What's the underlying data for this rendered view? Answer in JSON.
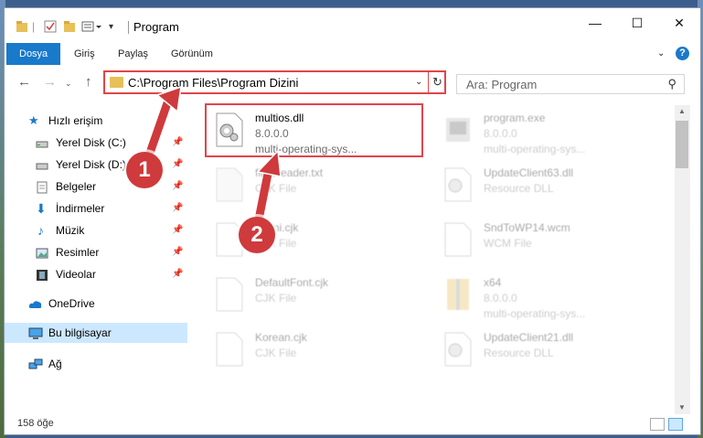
{
  "titlebar": {
    "title": "Program",
    "minimize": "—",
    "maximize": "☐",
    "close": "✕"
  },
  "ribbon": {
    "tabs": [
      "Dosya",
      "Giriş",
      "Paylaş",
      "Görünüm"
    ],
    "active_tab": "Dosya",
    "help": "?"
  },
  "address": {
    "path": "C:\\Program Files\\Program Dizini",
    "search_placeholder": "Ara: Program"
  },
  "nav": {
    "items": [
      {
        "label": "Hızlı erişim",
        "icon": "star-icon"
      },
      {
        "label": "Yerel Disk (C:)",
        "icon": "drive-icon"
      },
      {
        "label": "Yerel Disk (D:)",
        "icon": "drive-icon"
      },
      {
        "label": "Belgeler",
        "icon": "documents-icon"
      },
      {
        "label": "İndirmeler",
        "icon": "download-icon"
      },
      {
        "label": "Müzik",
        "icon": "music-icon"
      },
      {
        "label": "Resimler",
        "icon": "pictures-icon"
      },
      {
        "label": "Videolar",
        "icon": "video-icon"
      },
      {
        "label": "OneDrive",
        "icon": "cloud-icon"
      },
      {
        "label": "Bu bilgisayar",
        "icon": "computer-icon"
      },
      {
        "label": "Ağ",
        "icon": "network-icon"
      }
    ]
  },
  "files": [
    {
      "name": "multios.dll",
      "line2": "8.0.0.0",
      "line3": "multi-operating-sys..."
    },
    {
      "name": "program.exe",
      "line2": "8.0.0.0",
      "line3": "multi-operating-sys..."
    },
    {
      "name": "fineReader.txt",
      "line2": "CJK File",
      "line3": ""
    },
    {
      "name": "UpdateClient63.dll",
      "line2": "Resource DLL",
      "line3": ""
    },
    {
      "name": "fehmi.cjk",
      "line2": "CJK File",
      "line3": ""
    },
    {
      "name": "SndToWP14.wcm",
      "line2": "WCM File",
      "line3": ""
    },
    {
      "name": "DefaultFont.cjk",
      "line2": "CJK File",
      "line3": ""
    },
    {
      "name": "x64",
      "line2": "8.0.0.0",
      "line3": "multi-operating-sys..."
    },
    {
      "name": "Korean.cjk",
      "line2": "CJK File",
      "line3": ""
    },
    {
      "name": "UpdateClient21.dll",
      "line2": "Resource DLL",
      "line3": ""
    }
  ],
  "status": {
    "count": "158 öğe"
  },
  "callouts": [
    "1",
    "2"
  ],
  "colors": {
    "accent": "#1979ca",
    "highlight_red": "#e0454a"
  }
}
